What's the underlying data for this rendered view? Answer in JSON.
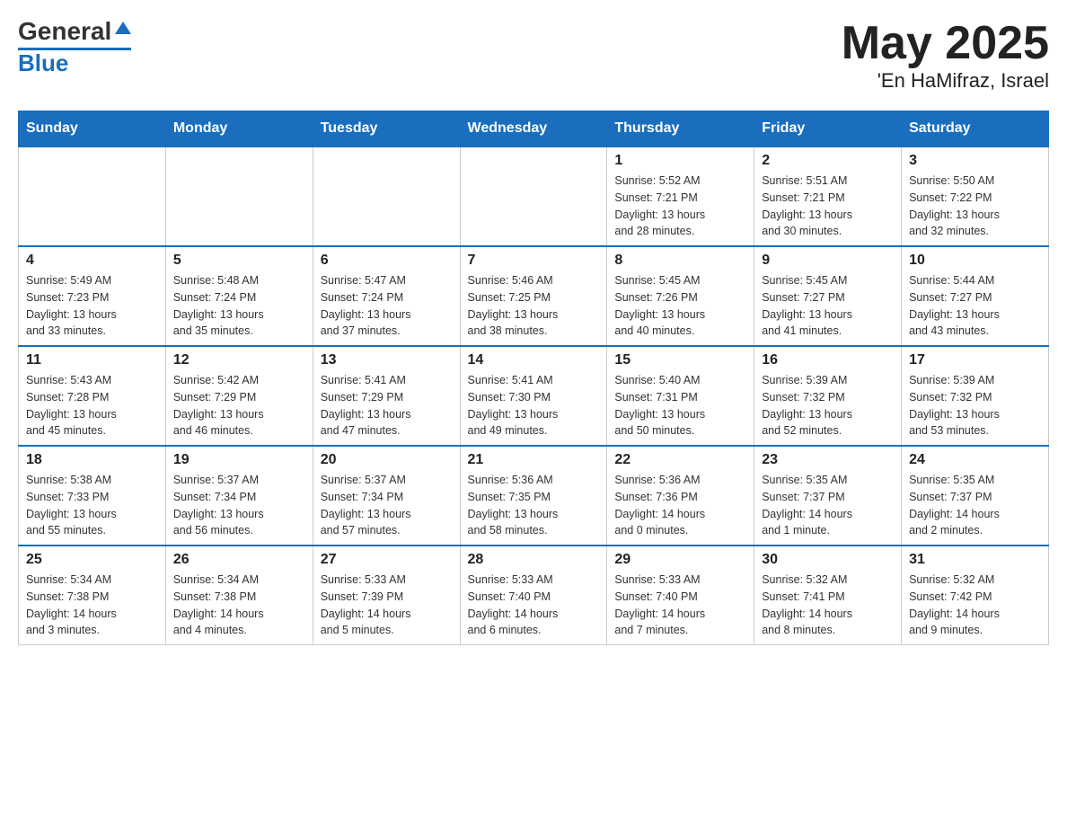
{
  "header": {
    "logo_line1": "General",
    "logo_line2": "Blue",
    "title": "May 2025",
    "subtitle": "'En HaMifraz, Israel"
  },
  "days_of_week": [
    "Sunday",
    "Monday",
    "Tuesday",
    "Wednesday",
    "Thursday",
    "Friday",
    "Saturday"
  ],
  "weeks": [
    {
      "days": [
        {
          "num": "",
          "info": ""
        },
        {
          "num": "",
          "info": ""
        },
        {
          "num": "",
          "info": ""
        },
        {
          "num": "",
          "info": ""
        },
        {
          "num": "1",
          "info": "Sunrise: 5:52 AM\nSunset: 7:21 PM\nDaylight: 13 hours\nand 28 minutes."
        },
        {
          "num": "2",
          "info": "Sunrise: 5:51 AM\nSunset: 7:21 PM\nDaylight: 13 hours\nand 30 minutes."
        },
        {
          "num": "3",
          "info": "Sunrise: 5:50 AM\nSunset: 7:22 PM\nDaylight: 13 hours\nand 32 minutes."
        }
      ]
    },
    {
      "days": [
        {
          "num": "4",
          "info": "Sunrise: 5:49 AM\nSunset: 7:23 PM\nDaylight: 13 hours\nand 33 minutes."
        },
        {
          "num": "5",
          "info": "Sunrise: 5:48 AM\nSunset: 7:24 PM\nDaylight: 13 hours\nand 35 minutes."
        },
        {
          "num": "6",
          "info": "Sunrise: 5:47 AM\nSunset: 7:24 PM\nDaylight: 13 hours\nand 37 minutes."
        },
        {
          "num": "7",
          "info": "Sunrise: 5:46 AM\nSunset: 7:25 PM\nDaylight: 13 hours\nand 38 minutes."
        },
        {
          "num": "8",
          "info": "Sunrise: 5:45 AM\nSunset: 7:26 PM\nDaylight: 13 hours\nand 40 minutes."
        },
        {
          "num": "9",
          "info": "Sunrise: 5:45 AM\nSunset: 7:27 PM\nDaylight: 13 hours\nand 41 minutes."
        },
        {
          "num": "10",
          "info": "Sunrise: 5:44 AM\nSunset: 7:27 PM\nDaylight: 13 hours\nand 43 minutes."
        }
      ]
    },
    {
      "days": [
        {
          "num": "11",
          "info": "Sunrise: 5:43 AM\nSunset: 7:28 PM\nDaylight: 13 hours\nand 45 minutes."
        },
        {
          "num": "12",
          "info": "Sunrise: 5:42 AM\nSunset: 7:29 PM\nDaylight: 13 hours\nand 46 minutes."
        },
        {
          "num": "13",
          "info": "Sunrise: 5:41 AM\nSunset: 7:29 PM\nDaylight: 13 hours\nand 47 minutes."
        },
        {
          "num": "14",
          "info": "Sunrise: 5:41 AM\nSunset: 7:30 PM\nDaylight: 13 hours\nand 49 minutes."
        },
        {
          "num": "15",
          "info": "Sunrise: 5:40 AM\nSunset: 7:31 PM\nDaylight: 13 hours\nand 50 minutes."
        },
        {
          "num": "16",
          "info": "Sunrise: 5:39 AM\nSunset: 7:32 PM\nDaylight: 13 hours\nand 52 minutes."
        },
        {
          "num": "17",
          "info": "Sunrise: 5:39 AM\nSunset: 7:32 PM\nDaylight: 13 hours\nand 53 minutes."
        }
      ]
    },
    {
      "days": [
        {
          "num": "18",
          "info": "Sunrise: 5:38 AM\nSunset: 7:33 PM\nDaylight: 13 hours\nand 55 minutes."
        },
        {
          "num": "19",
          "info": "Sunrise: 5:37 AM\nSunset: 7:34 PM\nDaylight: 13 hours\nand 56 minutes."
        },
        {
          "num": "20",
          "info": "Sunrise: 5:37 AM\nSunset: 7:34 PM\nDaylight: 13 hours\nand 57 minutes."
        },
        {
          "num": "21",
          "info": "Sunrise: 5:36 AM\nSunset: 7:35 PM\nDaylight: 13 hours\nand 58 minutes."
        },
        {
          "num": "22",
          "info": "Sunrise: 5:36 AM\nSunset: 7:36 PM\nDaylight: 14 hours\nand 0 minutes."
        },
        {
          "num": "23",
          "info": "Sunrise: 5:35 AM\nSunset: 7:37 PM\nDaylight: 14 hours\nand 1 minute."
        },
        {
          "num": "24",
          "info": "Sunrise: 5:35 AM\nSunset: 7:37 PM\nDaylight: 14 hours\nand 2 minutes."
        }
      ]
    },
    {
      "days": [
        {
          "num": "25",
          "info": "Sunrise: 5:34 AM\nSunset: 7:38 PM\nDaylight: 14 hours\nand 3 minutes."
        },
        {
          "num": "26",
          "info": "Sunrise: 5:34 AM\nSunset: 7:38 PM\nDaylight: 14 hours\nand 4 minutes."
        },
        {
          "num": "27",
          "info": "Sunrise: 5:33 AM\nSunset: 7:39 PM\nDaylight: 14 hours\nand 5 minutes."
        },
        {
          "num": "28",
          "info": "Sunrise: 5:33 AM\nSunset: 7:40 PM\nDaylight: 14 hours\nand 6 minutes."
        },
        {
          "num": "29",
          "info": "Sunrise: 5:33 AM\nSunset: 7:40 PM\nDaylight: 14 hours\nand 7 minutes."
        },
        {
          "num": "30",
          "info": "Sunrise: 5:32 AM\nSunset: 7:41 PM\nDaylight: 14 hours\nand 8 minutes."
        },
        {
          "num": "31",
          "info": "Sunrise: 5:32 AM\nSunset: 7:42 PM\nDaylight: 14 hours\nand 9 minutes."
        }
      ]
    }
  ]
}
